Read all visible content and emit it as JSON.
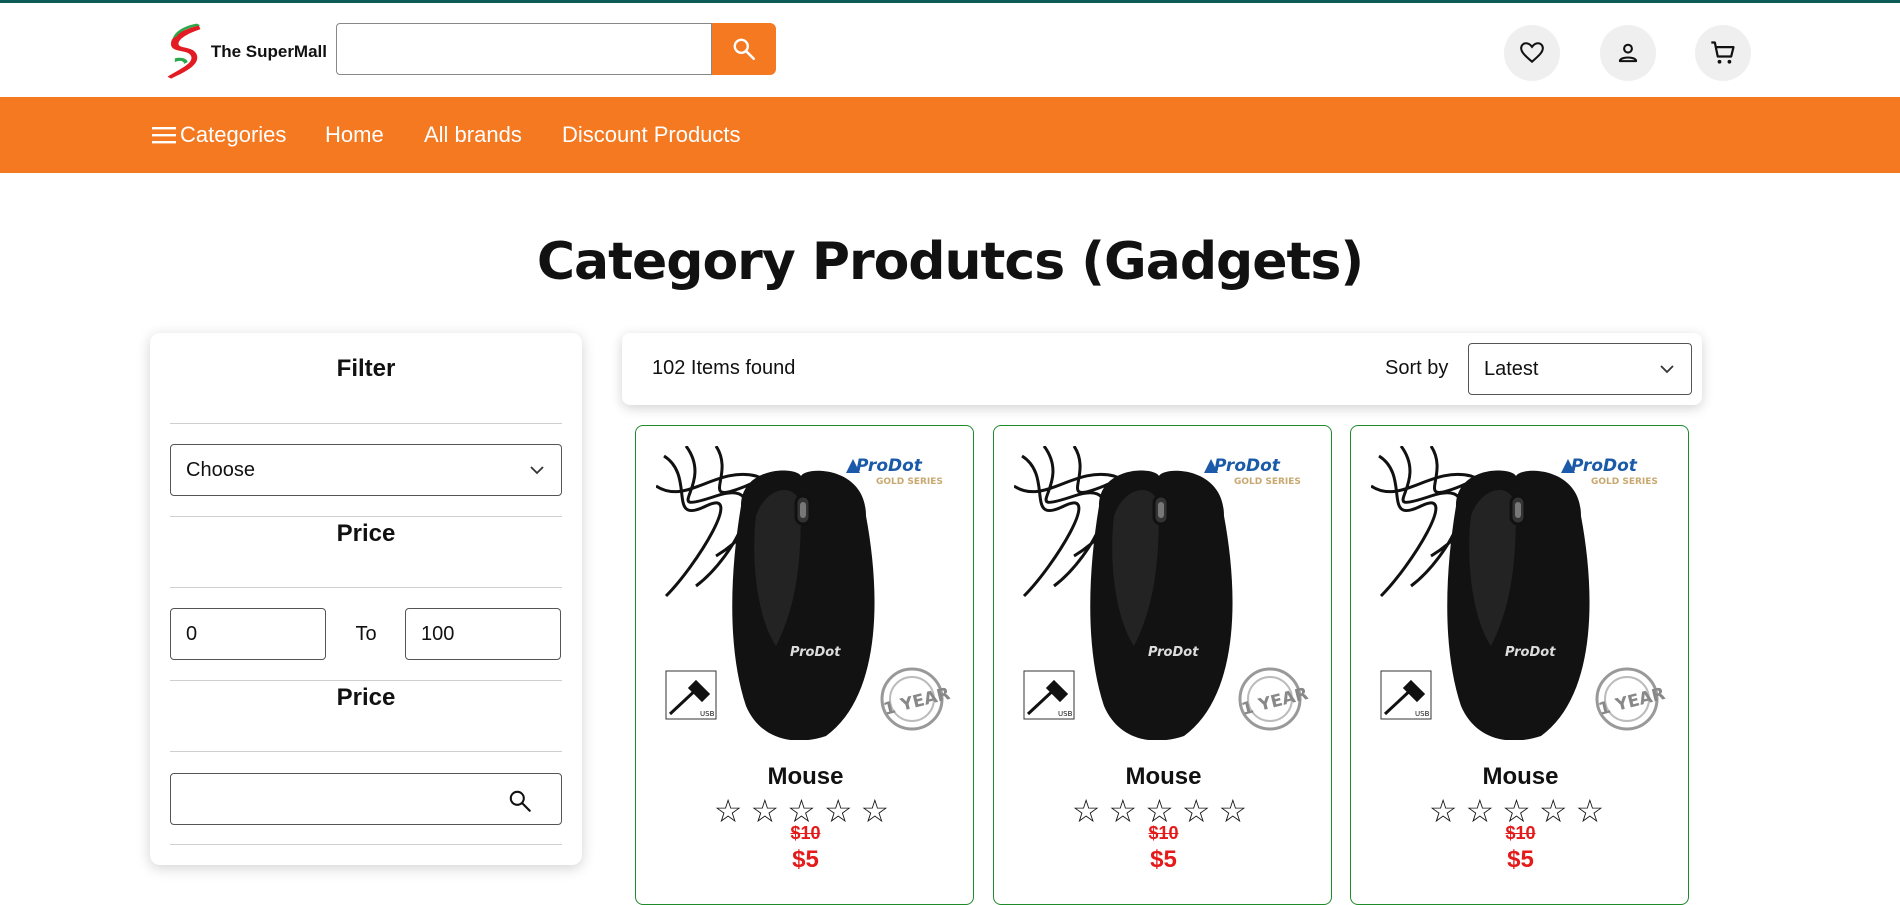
{
  "header": {
    "logo_text": "The SuperMall",
    "search_value": "",
    "icons": [
      "search-icon",
      "heart-icon",
      "user-icon",
      "cart-icon"
    ]
  },
  "nav": {
    "items": [
      "Categories",
      "Home",
      "All brands",
      "Discount Products"
    ]
  },
  "page": {
    "title": "Category Produtcs (Gadgets)"
  },
  "filter": {
    "title": "Filter",
    "category_select": "Choose",
    "price_label": "Price",
    "price_min": "0",
    "price_to": "To",
    "price_max": "100",
    "search_label": "Price",
    "search_value": ""
  },
  "results": {
    "count_text": "102 Items found",
    "sort_label": "Sort by",
    "sort_value": "Latest"
  },
  "products": [
    {
      "name": "Mouse",
      "stars": "☆☆☆☆☆",
      "rating": 0,
      "old_price": "$10",
      "price": "$5",
      "brand_text": "ProDot",
      "series_text": "GOLD SERIES",
      "badge_text": "1 YEAR",
      "usb_text": "USB"
    },
    {
      "name": "Mouse",
      "stars": "☆☆☆☆☆",
      "rating": 0,
      "old_price": "$10",
      "price": "$5",
      "brand_text": "ProDot",
      "series_text": "GOLD SERIES",
      "badge_text": "1 YEAR",
      "usb_text": "USB"
    },
    {
      "name": "Mouse",
      "stars": "☆☆☆☆☆",
      "rating": 0,
      "old_price": "$10",
      "price": "$5",
      "brand_text": "ProDot",
      "series_text": "GOLD SERIES",
      "badge_text": "1 YEAR",
      "usb_text": "USB"
    }
  ],
  "colors": {
    "accent": "#f47920",
    "top_line": "#0d5b57",
    "card_border": "#1e8a2a",
    "price": "#e51a1a"
  }
}
